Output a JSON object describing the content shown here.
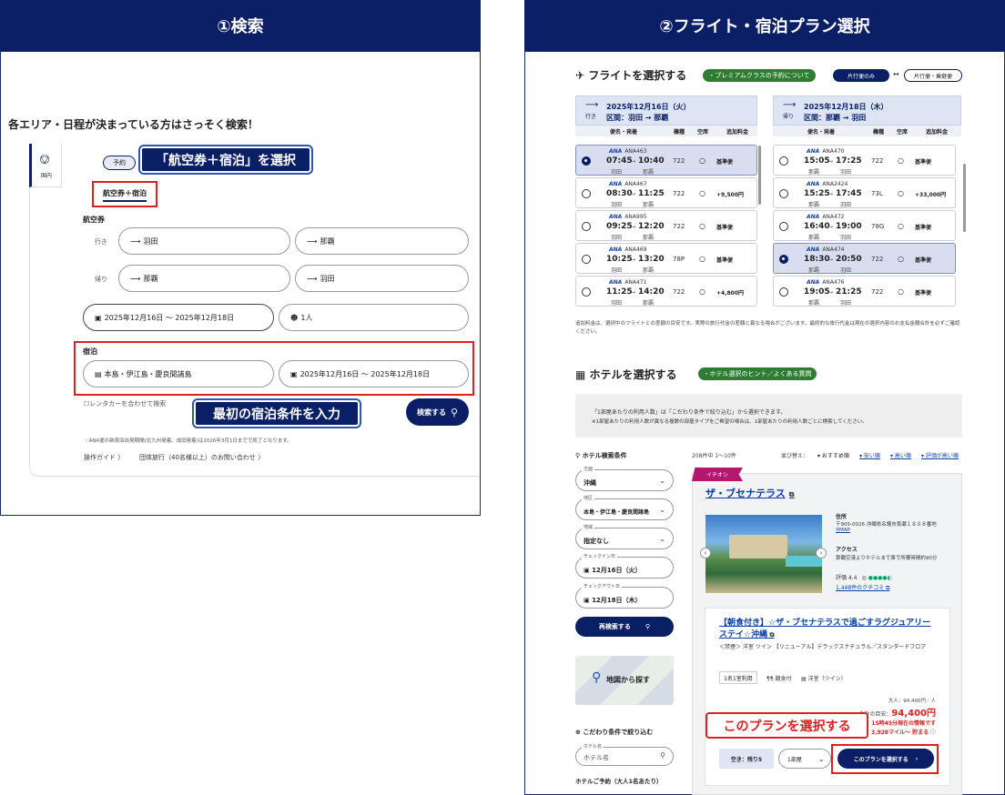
{
  "left": {
    "header": "①検索",
    "intro": "各エリア・日程が決まっている方はさっそく検索！",
    "sidebar_tab": "国内",
    "reserve_badge": "予約",
    "callout_top": "「航空券＋宿泊」を選択",
    "tab_selected": "航空券＋宿泊",
    "flight_section": "航空券",
    "outbound_label": "行き",
    "return_label": "帰り",
    "out_from": "羽田",
    "out_to": "那覇",
    "ret_from": "那覇",
    "ret_to": "羽田",
    "dates": "2025年12月16日 〜 2025年12月18日",
    "people": "1人",
    "stay_section": "宿泊",
    "stay_area": "本島・伊江島・慶良間諸島",
    "stay_dates": "2025年12月16日 〜 2025年12月18日",
    "rental_car": "レンタカーを合わせて検索",
    "callout_bottom": "最初の宿泊条件を入力",
    "search_button": "検索する",
    "footnote": "・ANA便の新宿泊出発期間(北九州発着、成田発着)は2026年3月1日までで終了となります。",
    "guide_link": "操作ガイド 〉",
    "group_link": "団体旅行（40名様以上）のお問い合わせ 〉"
  },
  "right": {
    "header": "②フライト・宿泊プラン選択",
    "flight_title": "フライトを選択する",
    "premium_pill": "・プレミアムクラスの予約について",
    "toggle_oneway": "片行便のみ",
    "toggle_arrow": "↔",
    "toggle_roundtrip": "片行便・乗継便",
    "out_head_label": "行き",
    "out_head_date": "2025年12月16日（火）",
    "out_head_route": "区間：羽田 → 那覇",
    "ret_head_label": "帰り",
    "ret_head_date": "2025年12月18日（木）",
    "ret_head_route": "区間：那覇 → 羽田",
    "col_flight": "便名・発着",
    "col_type": "機種",
    "col_seat": "空席",
    "col_fee": "追加料金",
    "out_flights": [
      {
        "num": "ANA463",
        "dep": "07:45",
        "arr": "10:40",
        "from": "羽田",
        "to": "那覇",
        "type": "722",
        "seat": "○",
        "fee": "基準便",
        "selected": true
      },
      {
        "num": "ANA467",
        "dep": "08:30",
        "arr": "11:25",
        "from": "羽田",
        "to": "那覇",
        "type": "722",
        "seat": "○",
        "fee": "+9,500円",
        "selected": false
      },
      {
        "num": "ANA995",
        "dep": "09:25",
        "arr": "12:20",
        "from": "羽田",
        "to": "那覇",
        "type": "722",
        "seat": "○",
        "fee": "基準便",
        "selected": false
      },
      {
        "num": "ANA469",
        "dep": "10:25",
        "arr": "13:20",
        "from": "羽田",
        "to": "那覇",
        "type": "78P",
        "seat": "○",
        "fee": "基準便",
        "selected": false
      },
      {
        "num": "ANA471",
        "dep": "11:25",
        "arr": "14:20",
        "from": "羽田",
        "to": "那覇",
        "type": "722",
        "seat": "○",
        "fee": "+4,800円",
        "selected": false
      }
    ],
    "ret_flights": [
      {
        "num": "ANA470",
        "dep": "15:05",
        "arr": "17:25",
        "from": "那覇",
        "to": "羽田",
        "type": "722",
        "seat": "○",
        "fee": "基準便",
        "selected": false
      },
      {
        "num": "ANA2424",
        "dep": "15:25",
        "arr": "17:45",
        "from": "那覇",
        "to": "羽田",
        "type": "73L",
        "seat": "○",
        "fee": "+33,000円",
        "selected": false
      },
      {
        "num": "ANA472",
        "dep": "16:40",
        "arr": "19:00",
        "from": "那覇",
        "to": "羽田",
        "type": "78G",
        "seat": "○",
        "fee": "基準便",
        "selected": false
      },
      {
        "num": "ANA474",
        "dep": "18:30",
        "arr": "20:50",
        "from": "那覇",
        "to": "羽田",
        "type": "722",
        "seat": "○",
        "fee": "基準便",
        "selected": true
      },
      {
        "num": "ANA476",
        "dep": "19:05",
        "arr": "21:25",
        "from": "那覇",
        "to": "羽田",
        "type": "722",
        "seat": "○",
        "fee": "基準便",
        "selected": false
      }
    ],
    "ana_mark": "ANA",
    "codeshare_mark": "SNA運航",
    "fee_note": "追加料金は、選択中のフライトとの差額の目安です。実際の旅行代金の差額と異なる場合がございます。最終的な旅行代金は現在の選択内容のお支払金額合計を必ずご確認ください。",
    "hotel_title": "ホテルを選択する",
    "hotel_tips": "・ホテル選択のヒント／よくある質問",
    "info_line1": "「1部屋あたりの利用人数」は「こだわり条件で絞り込む」から選択できます。",
    "info_line2": "※1部屋あたりの利用人数が異なる複数の部屋タイプをご希望の場合は、1部屋あたりの利用人数ごとに検索してください。",
    "search_cond": "ホテル検索条件",
    "result_count": "208件中 1〜10件",
    "sort_label": "並び替え：",
    "sort_options": [
      "おすすめ順",
      "安い順",
      "高い順",
      "評価が高い順"
    ],
    "side_direction_label": "方面",
    "side_direction": "沖縄",
    "side_area_label": "地区",
    "side_area": "本島・伊江島・慶良間諸島",
    "side_region_label": "地域",
    "side_region": "指定なし",
    "checkin_label": "チェックイン日",
    "checkin": "12月16日（火）",
    "checkout_label": "チェックアウト日",
    "checkout": "12月18日（木）",
    "research_button": "再検索する",
    "map_button": "地図から探す",
    "filter_title": "こだわり条件で絞り込む",
    "hotel_name_label": "ホテル名",
    "hotel_name_placeholder": "ホテル名",
    "people_label": "ホテルご予約（大人1名あたり）",
    "ichioshi": "イチオシ",
    "hotel_name": "ザ・ブセナテラス",
    "addr_label": "住所",
    "addr": "〒905-0026 沖縄県名護市喜瀬１８０８番地",
    "map_link": "MAP",
    "access_label": "アクセス",
    "access": "那覇空港よりホテルまで車で所要時間約90分",
    "rating_label": "評価 4.4",
    "reviews_link": "1,448件のクチコミ",
    "plan_title": "【朝食付き】☆ザ・ブセナテラスで過ごすラグジュアリーステイ☆沖縄",
    "plan_desc": "＜禁煙＞ 洋室 ツイン 【リニューアル】デラックスナチュラル／スタンダードフロア",
    "tag_people": "1名1室利用",
    "tag_meal": "朝食付",
    "tag_room": "洋室（ツイン）",
    "price_per": "大人：94,400円／人",
    "price_label": "合計の目安：",
    "price": "94,400円",
    "price_note": "15時45分現在の情報です",
    "mile_note": "3,928マイル〜 貯まる",
    "vacancy": "空き：残り5",
    "rooms": "1部屋",
    "choose_button": "このプランを選択する",
    "callout": "このプランを選択する"
  }
}
